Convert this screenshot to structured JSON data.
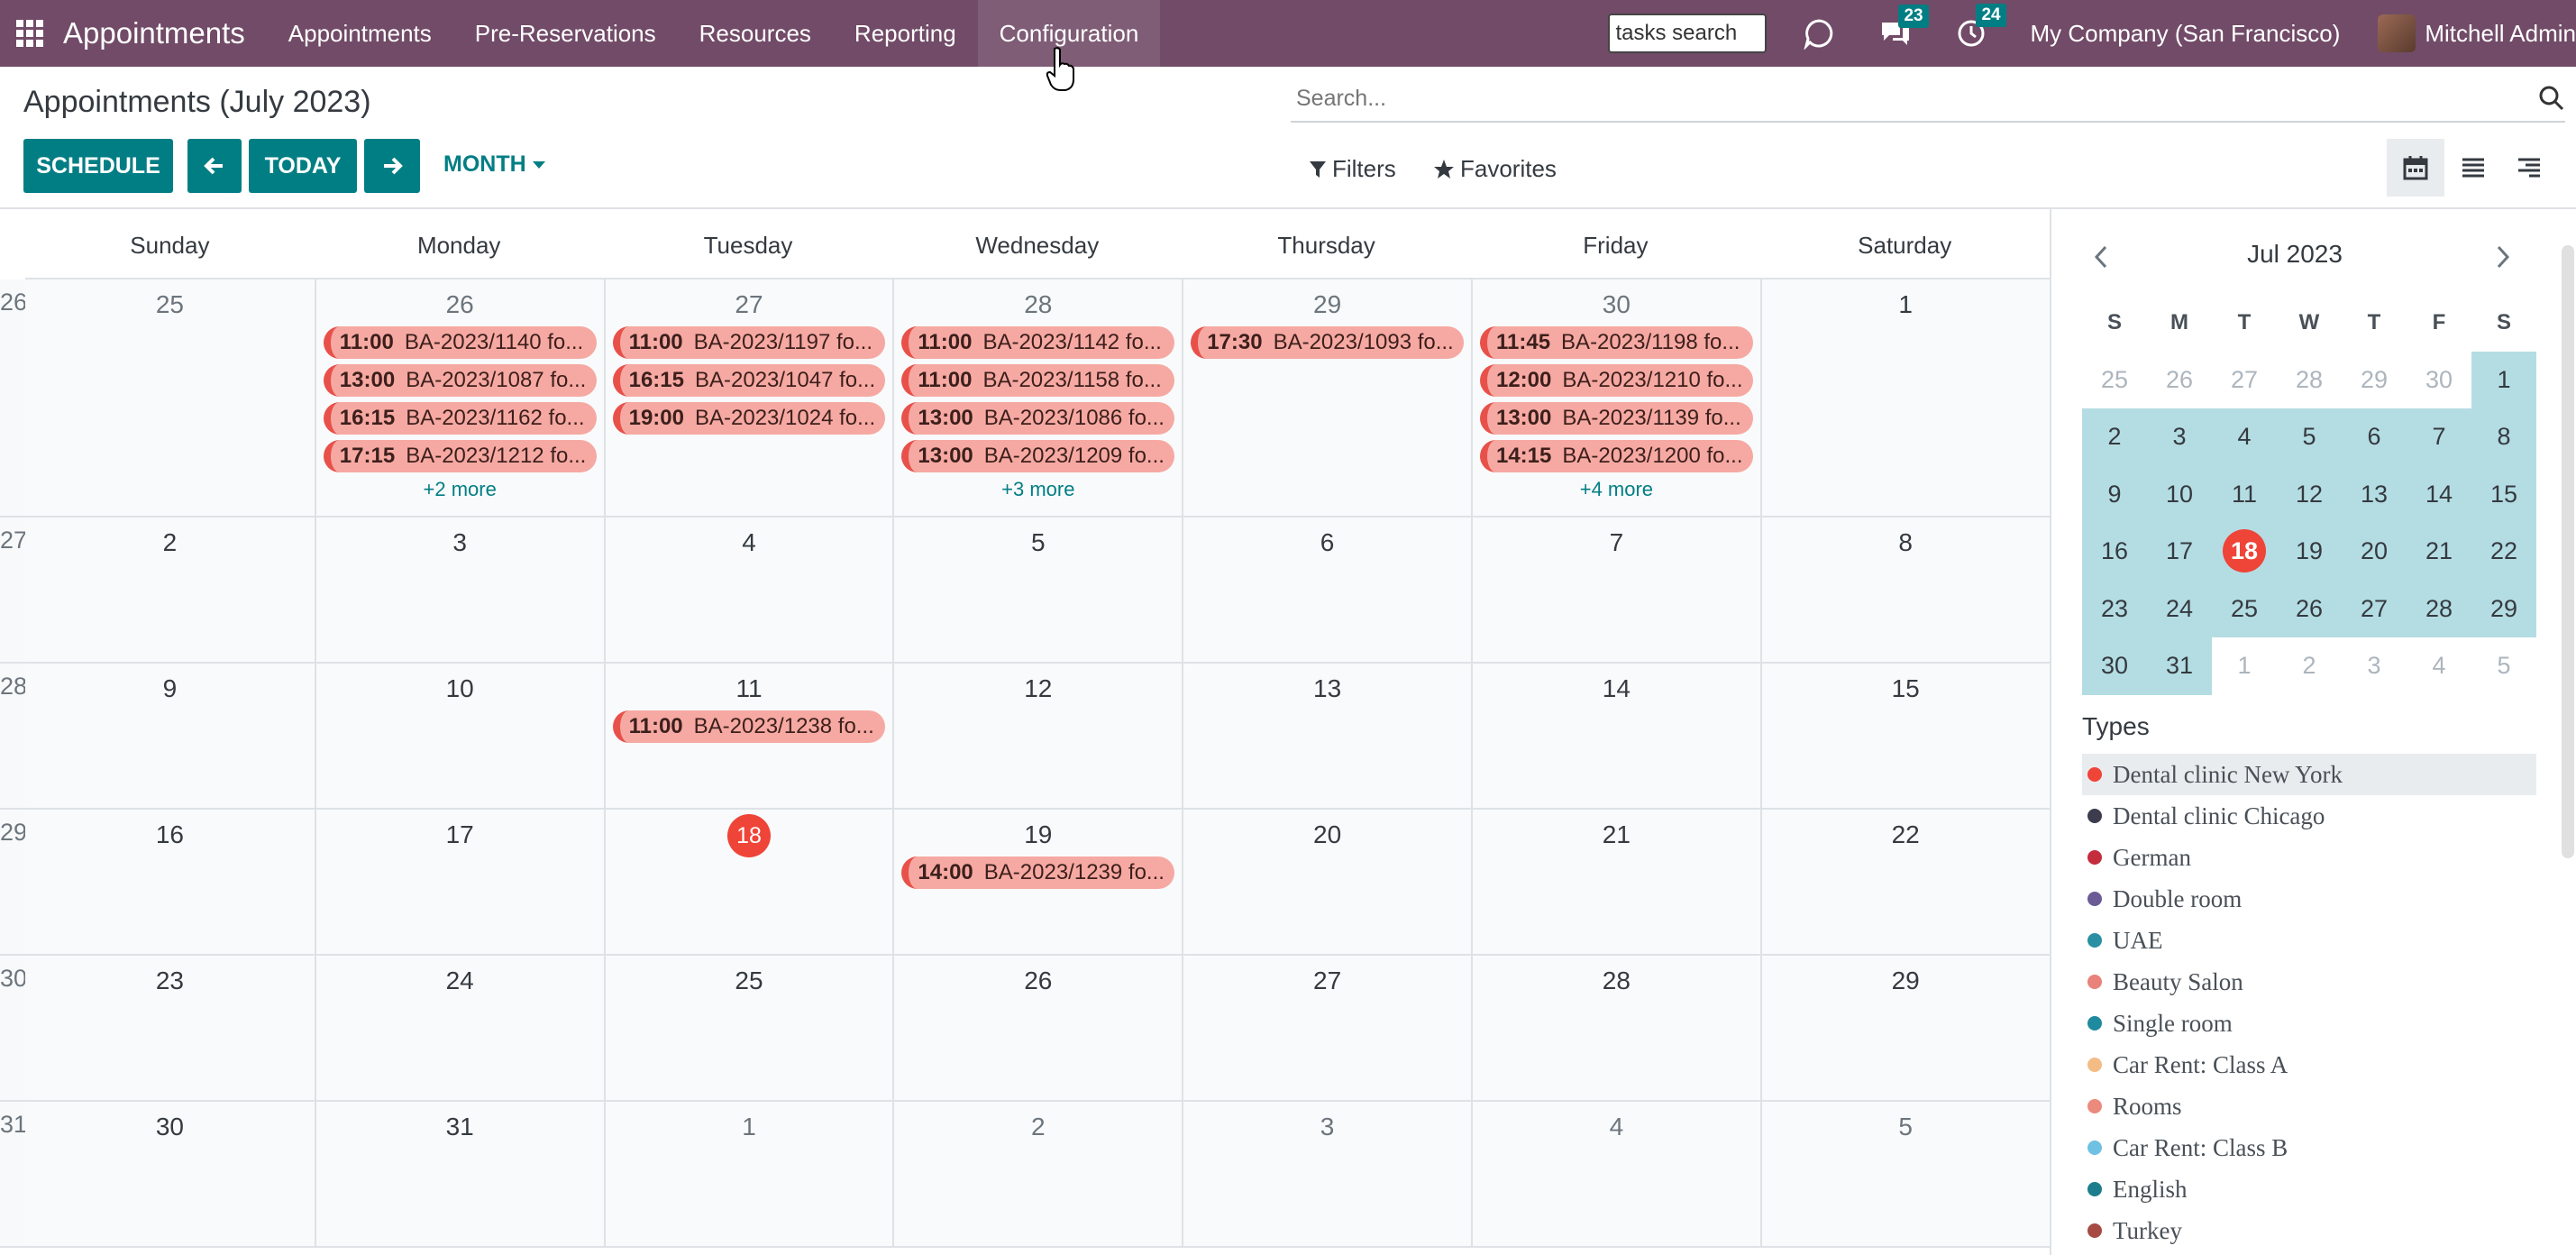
{
  "navbar": {
    "brand": "Appointments",
    "menu": [
      "Appointments",
      "Pre-Reservations",
      "Resources",
      "Reporting",
      "Configuration"
    ],
    "task_search_value": "tasks search",
    "messages_count": "23",
    "activities_count": "24",
    "company": "My Company (San Francisco)",
    "user": "Mitchell Admin"
  },
  "control": {
    "breadcrumb": "Appointments (July 2023)",
    "search_placeholder": "Search...",
    "schedule": "SCHEDULE",
    "today": "TODAY",
    "scale": "MONTH",
    "filters": "Filters",
    "favorites": "Favorites"
  },
  "calendar": {
    "day_headers": [
      "Sunday",
      "Monday",
      "Tuesday",
      "Wednesday",
      "Thursday",
      "Friday",
      "Saturday"
    ],
    "weeks": [
      {
        "num": "26",
        "days": [
          {
            "n": "25",
            "other": true,
            "events": []
          },
          {
            "n": "26",
            "other": true,
            "events": [
              [
                "11:00",
                "BA-2023/1140 fo..."
              ],
              [
                "13:00",
                "BA-2023/1087 fo..."
              ],
              [
                "16:15",
                "BA-2023/1162 fo..."
              ],
              [
                "17:15",
                "BA-2023/1212 fo..."
              ]
            ],
            "more": "+2 more"
          },
          {
            "n": "27",
            "other": true,
            "events": [
              [
                "11:00",
                "BA-2023/1197 fo..."
              ],
              [
                "16:15",
                "BA-2023/1047 fo..."
              ],
              [
                "19:00",
                "BA-2023/1024 fo..."
              ]
            ]
          },
          {
            "n": "28",
            "other": true,
            "events": [
              [
                "11:00",
                "BA-2023/1142 fo..."
              ],
              [
                "11:00",
                "BA-2023/1158 fo..."
              ],
              [
                "13:00",
                "BA-2023/1086 fo..."
              ],
              [
                "13:00",
                "BA-2023/1209 fo..."
              ]
            ],
            "more": "+3 more"
          },
          {
            "n": "29",
            "other": true,
            "events": [
              [
                "17:30",
                "BA-2023/1093 fo..."
              ]
            ]
          },
          {
            "n": "30",
            "other": true,
            "events": [
              [
                "11:45",
                "BA-2023/1198 fo..."
              ],
              [
                "12:00",
                "BA-2023/1210 fo..."
              ],
              [
                "13:00",
                "BA-2023/1139 fo..."
              ],
              [
                "14:15",
                "BA-2023/1200 fo..."
              ]
            ],
            "more": "+4 more"
          },
          {
            "n": "1",
            "other": false,
            "events": []
          }
        ]
      },
      {
        "num": "27",
        "days": [
          {
            "n": "2",
            "events": []
          },
          {
            "n": "3",
            "events": []
          },
          {
            "n": "4",
            "events": []
          },
          {
            "n": "5",
            "events": []
          },
          {
            "n": "6",
            "events": []
          },
          {
            "n": "7",
            "events": []
          },
          {
            "n": "8",
            "events": []
          }
        ]
      },
      {
        "num": "28",
        "days": [
          {
            "n": "9",
            "events": []
          },
          {
            "n": "10",
            "events": []
          },
          {
            "n": "11",
            "events": [
              [
                "11:00",
                "BA-2023/1238 fo..."
              ]
            ]
          },
          {
            "n": "12",
            "events": []
          },
          {
            "n": "13",
            "events": []
          },
          {
            "n": "14",
            "events": []
          },
          {
            "n": "15",
            "events": []
          }
        ]
      },
      {
        "num": "29",
        "days": [
          {
            "n": "16",
            "events": []
          },
          {
            "n": "17",
            "events": []
          },
          {
            "n": "18",
            "today": true,
            "events": []
          },
          {
            "n": "19",
            "events": [
              [
                "14:00",
                "BA-2023/1239 fo..."
              ]
            ]
          },
          {
            "n": "20",
            "events": []
          },
          {
            "n": "21",
            "events": []
          },
          {
            "n": "22",
            "events": []
          }
        ]
      },
      {
        "num": "30",
        "days": [
          {
            "n": "23",
            "events": []
          },
          {
            "n": "24",
            "events": []
          },
          {
            "n": "25",
            "events": []
          },
          {
            "n": "26",
            "events": []
          },
          {
            "n": "27",
            "events": []
          },
          {
            "n": "28",
            "events": []
          },
          {
            "n": "29",
            "events": []
          }
        ]
      },
      {
        "num": "31",
        "days": [
          {
            "n": "30",
            "events": []
          },
          {
            "n": "31",
            "events": []
          },
          {
            "n": "1",
            "other": true,
            "events": []
          },
          {
            "n": "2",
            "other": true,
            "events": []
          },
          {
            "n": "3",
            "other": true,
            "events": []
          },
          {
            "n": "4",
            "other": true,
            "events": []
          },
          {
            "n": "5",
            "other": true,
            "events": []
          }
        ]
      }
    ]
  },
  "mini": {
    "title": "Jul 2023",
    "dow": [
      "S",
      "M",
      "T",
      "W",
      "T",
      "F",
      "S"
    ],
    "rows": [
      [
        "25",
        "26",
        "27",
        "28",
        "29",
        "30",
        "1"
      ],
      [
        "2",
        "3",
        "4",
        "5",
        "6",
        "7",
        "8"
      ],
      [
        "9",
        "10",
        "11",
        "12",
        "13",
        "14",
        "15"
      ],
      [
        "16",
        "17",
        "18",
        "19",
        "20",
        "21",
        "22"
      ],
      [
        "23",
        "24",
        "25",
        "26",
        "27",
        "28",
        "29"
      ],
      [
        "30",
        "31",
        "1",
        "2",
        "3",
        "4",
        "5"
      ]
    ]
  },
  "types": {
    "title": "Types",
    "items": [
      {
        "label": "Dental clinic New York",
        "color": "#EF4438"
      },
      {
        "label": "Dental clinic Chicago",
        "color": "#3C3C4E"
      },
      {
        "label": "German",
        "color": "#C42D3B"
      },
      {
        "label": "Double room",
        "color": "#6B5B95"
      },
      {
        "label": "UAE",
        "color": "#2A8FA3"
      },
      {
        "label": "Beauty Salon",
        "color": "#E8827A"
      },
      {
        "label": "Single room",
        "color": "#1F8A9E"
      },
      {
        "label": "Car Rent: Class A",
        "color": "#F4BC85"
      },
      {
        "label": "Rooms",
        "color": "#EC8A7D"
      },
      {
        "label": "Car Rent: Class B",
        "color": "#6FC1E3"
      },
      {
        "label": "English",
        "color": "#1E7D8C"
      },
      {
        "label": "Turkey",
        "color": "#A64B43"
      }
    ]
  }
}
